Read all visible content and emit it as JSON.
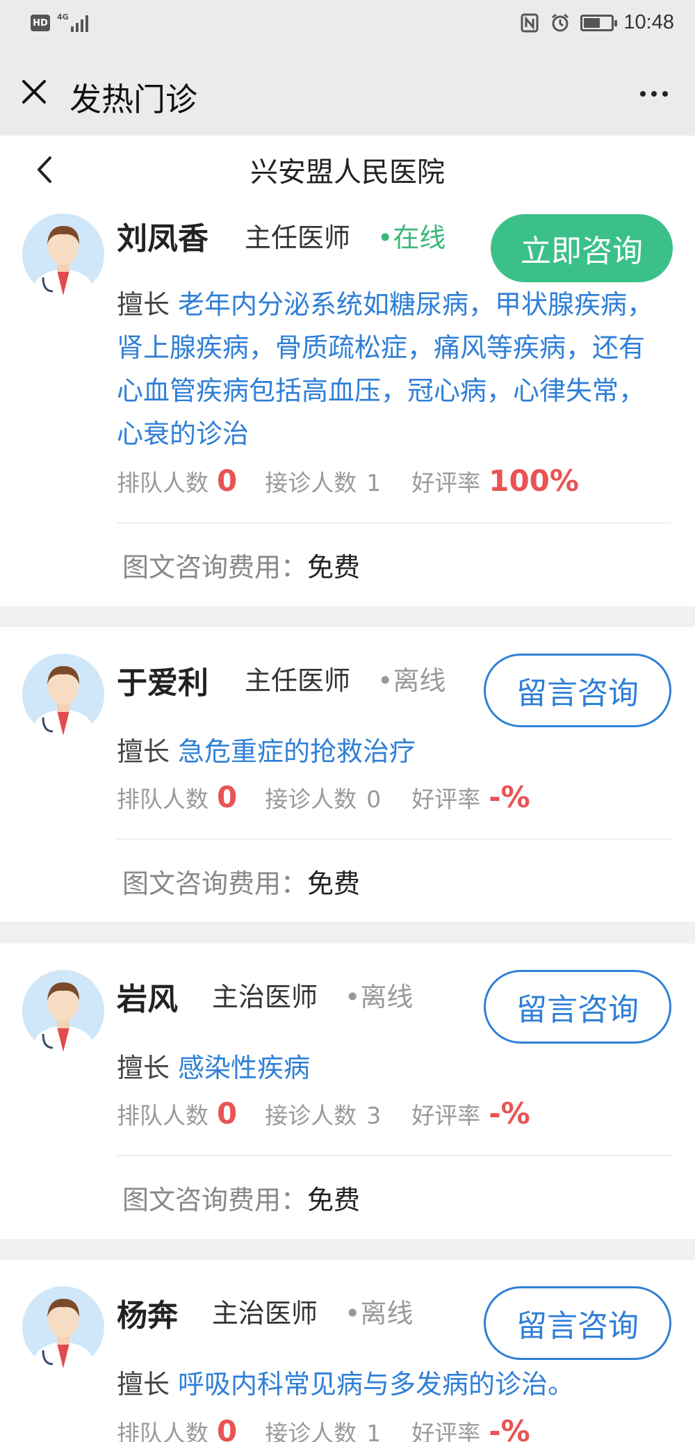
{
  "status_bar": {
    "hd_badge": "HD",
    "network": "4G",
    "time": "10:48",
    "battery_level": 0.6
  },
  "titlebar": {
    "title": "发热门诊"
  },
  "header": {
    "hospital_name": "兴安盟人民医院"
  },
  "colors": {
    "online": "#3cb878",
    "link_blue": "#2f7fd6",
    "accent_red": "#e85454",
    "primary_button": "#3cc08a"
  },
  "doctors": [
    {
      "name": "刘凤香",
      "rank": "主任医师",
      "status": "•在线",
      "button": "立即咨询",
      "specialty_label": "擅长",
      "specialty": "老年内分泌系统如糖尿病，甲状腺疾病，肾上腺疾病，骨质疏松症，痛风等疾病，还有心血管疾病包括高血压，冠心病，心律失常，心衰的诊治",
      "queue_label": "排队人数",
      "queue": "0",
      "treated_label": "接诊人数",
      "treated": "1",
      "rating_label": "好评率",
      "rating": "100%",
      "fee_label": "图文咨询费用：",
      "fee": "免费"
    },
    {
      "name": "于爱利",
      "rank": "主任医师",
      "status": "•离线",
      "button": "留言咨询",
      "specialty_label": "擅长",
      "specialty": "急危重症的抢救治疗",
      "queue_label": "排队人数",
      "queue": "0",
      "treated_label": "接诊人数",
      "treated": "0",
      "rating_label": "好评率",
      "rating": "-%",
      "fee_label": "图文咨询费用：",
      "fee": "免费"
    },
    {
      "name": "岩风",
      "rank": "主治医师",
      "status": "•离线",
      "button": "留言咨询",
      "specialty_label": "擅长",
      "specialty": "感染性疾病",
      "queue_label": "排队人数",
      "queue": "0",
      "treated_label": "接诊人数",
      "treated": "3",
      "rating_label": "好评率",
      "rating": "-%",
      "fee_label": "图文咨询费用：",
      "fee": "免费"
    },
    {
      "name": "杨奔",
      "rank": "主治医师",
      "status": "•离线",
      "button": "留言咨询",
      "specialty_label": "擅长",
      "specialty": "呼吸内科常见病与多发病的诊治。",
      "queue_label": "排队人数",
      "queue": "0",
      "treated_label": "接诊人数",
      "treated": "1",
      "rating_label": "好评率",
      "rating": "-%"
    }
  ]
}
